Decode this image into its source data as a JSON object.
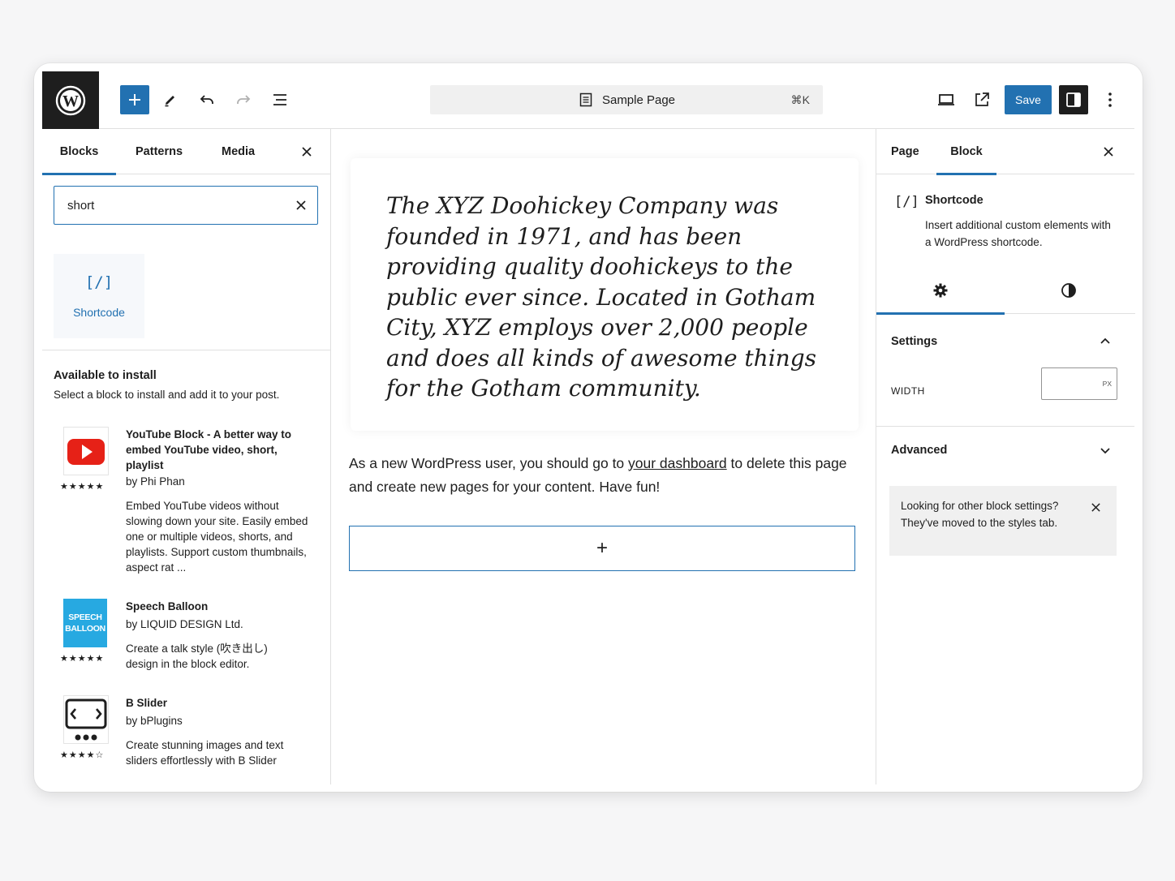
{
  "toolbar": {
    "document_title": "Sample Page",
    "shortcut": "⌘K",
    "save_label": "Save",
    "icons": [
      "wordpress-logo",
      "add-block-icon",
      "pencil-icon",
      "undo-icon",
      "redo-icon",
      "list-view-icon",
      "document-icon",
      "desktop-preview-icon",
      "external-link-icon",
      "sidebar-toggle-icon",
      "more-vertical-icon"
    ]
  },
  "inserter": {
    "tabs": [
      "Blocks",
      "Patterns",
      "Media"
    ],
    "active_tab": "Blocks",
    "search_value": "short",
    "result": {
      "icon": "[/]",
      "label": "Shortcode"
    },
    "install_heading": "Available to install",
    "install_sub": "Select a block to install and add it to your post.",
    "plugins": [
      {
        "name": "YouTube Block - A better way to embed YouTube video, short, playlist",
        "author": "by Phi Phan",
        "desc": "Embed YouTube videos without slowing down your site. Easily embed one or multiple videos, shorts, and playlists. Support custom thumbnails, aspect rat ...",
        "stars": "★★★★★",
        "rating": 5
      },
      {
        "name": "Speech Balloon",
        "author": "by LIQUID DESIGN Ltd.",
        "desc": "Create a talk style (吹き出し) design in the block editor.",
        "stars": "★★★★★",
        "rating": 5,
        "icon_text_1": "SPEECH",
        "icon_text_2": "BALLOON"
      },
      {
        "name": "B Slider",
        "author": "by bPlugins",
        "desc": "Create stunning images and text sliders effortlessly with B Slider",
        "stars": "★★★★☆",
        "rating": 4.5
      }
    ]
  },
  "canvas": {
    "quote": "The XYZ Doohickey Company was founded in 1971, and has been providing quality doohickeys to the public ever since. Located in Gotham City, XYZ employs over 2,000 people and does all kinds of awesome things for the Gotham community.",
    "para_before": "As a new WordPress user, you should go to ",
    "para_link": "your dashboard",
    "para_after": " to delete this page and create new pages for your content. Have fun!",
    "appender": "+"
  },
  "settings": {
    "tabs": [
      "Page",
      "Block"
    ],
    "active_tab": "Block",
    "block_icon": "[/]",
    "block_name": "Shortcode",
    "block_desc": "Insert additional custom elements with a WordPress shortcode.",
    "subtab_icons": [
      "gear-icon",
      "contrast-icon"
    ],
    "settings_heading": "Settings",
    "width_label": "WIDTH",
    "width_unit": "PX",
    "width_value": "",
    "advanced_heading": "Advanced",
    "notice": "Looking for other block settings? They've moved to the styles tab.",
    "accent": "#2271b1"
  }
}
